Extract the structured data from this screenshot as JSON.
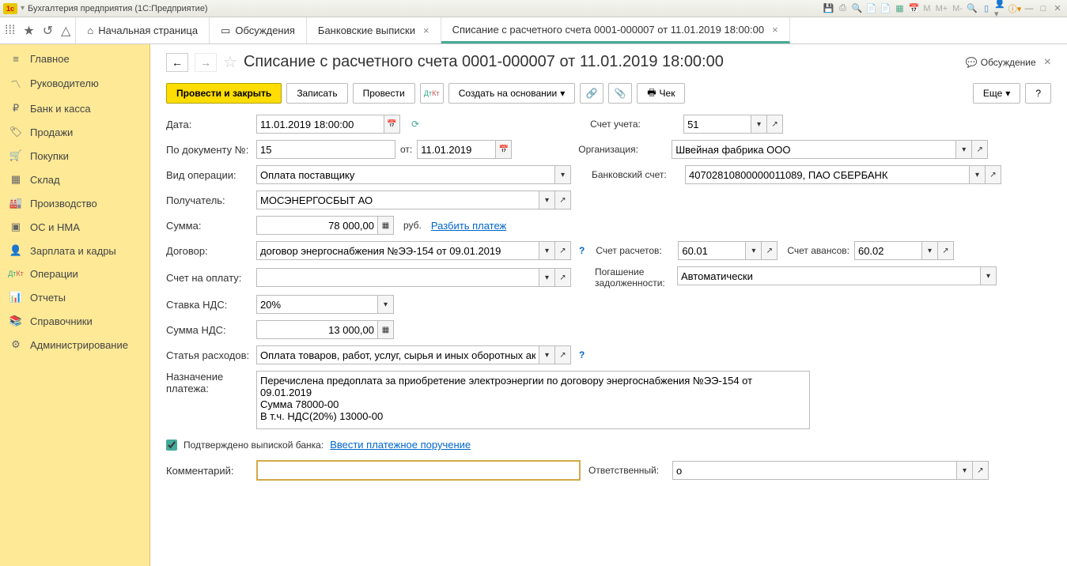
{
  "app": {
    "title": "Бухгалтерия предприятия  (1С:Предприятие)"
  },
  "tabs": {
    "home": "Начальная страница",
    "discuss": "Обсуждения",
    "bank": "Банковские выписки",
    "current": "Списание с расчетного счета 0001-000007 от 11.01.2019 18:00:00"
  },
  "sidebar": {
    "main": "Главное",
    "mgr": "Руководителю",
    "bank": "Банк и касса",
    "sales": "Продажи",
    "buy": "Покупки",
    "stock": "Склад",
    "prod": "Производство",
    "os": "ОС и НМА",
    "salary": "Зарплата и кадры",
    "ops": "Операции",
    "reports": "Отчеты",
    "refs": "Справочники",
    "admin": "Администрирование"
  },
  "doc": {
    "title": "Списание с расчетного счета 0001-000007 от 11.01.2019 18:00:00",
    "discuss_btn": "Обсуждение"
  },
  "toolbar": {
    "post_close": "Провести и закрыть",
    "write": "Записать",
    "post": "Провести",
    "create_based": "Создать на основании",
    "check": "Чек",
    "more": "Еще",
    "help": "?"
  },
  "form": {
    "date_lbl": "Дата:",
    "date_val": "11.01.2019 18:00:00",
    "account_lbl": "Счет учета:",
    "account_val": "51",
    "docnum_lbl": "По документу №:",
    "docnum_val": "15",
    "from_lbl": "от:",
    "from_val": "11.01.2019",
    "org_lbl": "Организация:",
    "org_val": "Швейная фабрика ООО",
    "optype_lbl": "Вид операции:",
    "optype_val": "Оплата поставщику",
    "bankacc_lbl": "Банковский счет:",
    "bankacc_val": "40702810800000011089, ПАО СБЕРБАНК",
    "recipient_lbl": "Получатель:",
    "recipient_val": "МОСЭНЕРГОСБЫТ АО",
    "sum_lbl": "Сумма:",
    "sum_val": "78 000,00",
    "currency": "руб.",
    "split_pay": "Разбить платеж",
    "contract_lbl": "Договор:",
    "contract_val": "договор энергоснабжения №ЭЭ-154 от 09.01.2019",
    "calcacc_lbl": "Счет расчетов:",
    "calcacc_val": "60.01",
    "advacc_lbl": "Счет авансов:",
    "advacc_val": "60.02",
    "payacc_lbl": "Счет на оплату:",
    "debt_lbl1": "Погашение",
    "debt_lbl2": "задолженности:",
    "debt_val": "Автоматически",
    "vatrate_lbl": "Ставка НДС:",
    "vatrate_val": "20%",
    "vatsum_lbl": "Сумма НДС:",
    "vatsum_val": "13 000,00",
    "expense_lbl": "Статья расходов:",
    "expense_val": "Оплата товаров, работ, услуг, сырья и иных оборотных акти",
    "purpose_lbl1": "Назначение",
    "purpose_lbl2": "платежа:",
    "purpose_val": "Перечислена предоплата за приобретение электроэнергии по договору энергоснабжения №ЭЭ-154 от 09.01.2019\nСумма 78000-00\nВ т.ч. НДС(20%) 13000-00",
    "confirmed": "Подтверждено выпиской банка:",
    "enter_pay": "Ввести платежное поручение",
    "comment_lbl": "Комментарий:",
    "resp_lbl": "Ответственный:",
    "resp_val": "о"
  }
}
